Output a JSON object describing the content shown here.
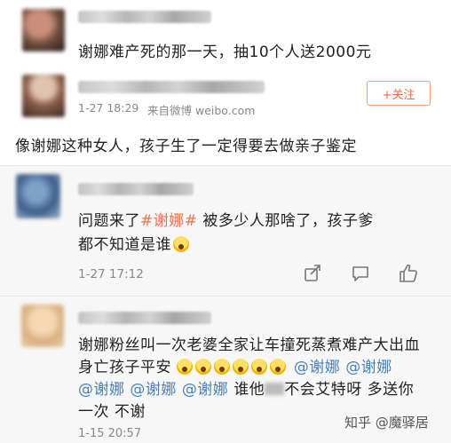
{
  "post": {
    "text": "谢娜难产死的那一天，抽10个人送2000元"
  },
  "comment1": {
    "timestamp": "1-27 18:29",
    "source": "来自微博 weibo.com",
    "follow_label": "+关注",
    "text": "像谢娜这种女人，孩子生了一定得要去做亲子鉴定"
  },
  "comment2": {
    "name_blurred": "小熊等往就好",
    "line1_prefix": "问题来了",
    "hashtag": "#谢娜#",
    "line1_suffix": "被多少人那啥了，孩子爹",
    "line2": "都不知道是谁",
    "timestamp": "1-27 17:12"
  },
  "comment3": {
    "line1": "谢娜粉丝叫一次老婆全家让车撞死蒸煮难产大出血",
    "line2_prefix": "身亡孩子平安",
    "mention": "@谢娜",
    "line4_suffix_a": "谁他",
    "line4_suffix_b": "不会艾特呀 多送你",
    "line5": "一次 不谢",
    "timestamp": "1-15 20:57"
  },
  "watermark": "知乎 @魔驿居",
  "icons": [
    "share-icon",
    "comment-icon",
    "like-icon",
    "crying-emoji-icon",
    "scream-emoji-icon"
  ],
  "colors": {
    "hashtag": "#eb7350",
    "mention": "#4a7fb8",
    "follow": "#e86f3c"
  }
}
